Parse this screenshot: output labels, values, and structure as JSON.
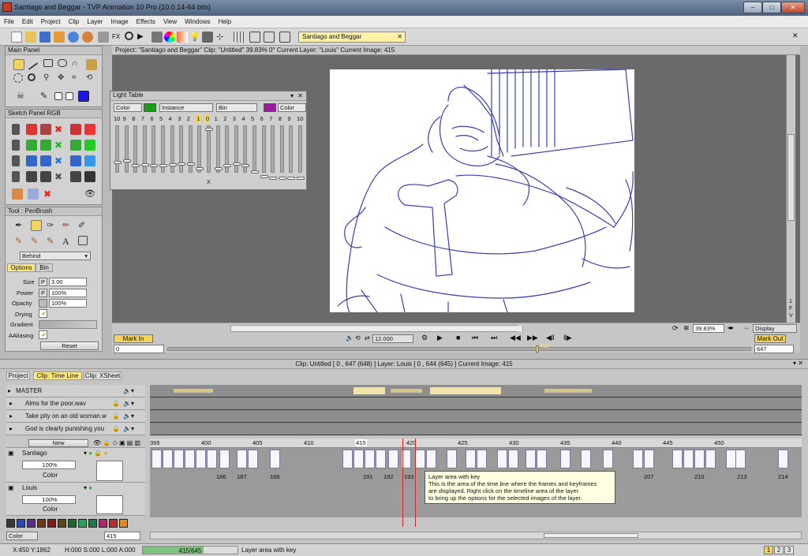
{
  "window": {
    "title": "Santiago and Beggar - TVP Animation 10 Pro (10.0.14-64 bits)"
  },
  "menu": [
    "File",
    "Edit",
    "Project",
    "Clip",
    "Layer",
    "Image",
    "Effects",
    "View",
    "Windows",
    "Help"
  ],
  "project_tab": "Santiago and Beggar",
  "main_panel": {
    "title": "Main Panel"
  },
  "sketch_panel": {
    "title": "Sketch Panel RGB"
  },
  "tool_panel": {
    "title": "Tool : PenBrush",
    "mode": "Behind",
    "tabs": [
      "Options",
      "Bin"
    ],
    "size": "3.00",
    "power": "100%",
    "opacity": "100%",
    "labels": {
      "size": "Size",
      "power": "Power",
      "opacity": "Opacity",
      "drying": "Drying",
      "gradient": "Gradient",
      "aaliasing": "AAliasing"
    },
    "reset": "Reset",
    "p": "P"
  },
  "view_header": "Project: \"Santiago and Beggar\"  Clip: \"Untitled\"  39.83%  0°  Current Layer: \"Louis\"  Current Image: 415",
  "light_table": {
    "title": "Light Table",
    "left_color": "Color",
    "mode": "Instance",
    "right_mode": "Bin",
    "right_color": "Color",
    "numbers": [
      "10",
      "9",
      "8",
      "7",
      "6",
      "5",
      "4",
      "3",
      "2",
      "1",
      "0",
      "1",
      "2",
      "3",
      "4",
      "5",
      "6",
      "7",
      "8",
      "9",
      "10"
    ],
    "x": "X"
  },
  "playbar": {
    "mark_in": "Mark In",
    "mark_out": "Mark Out",
    "fps": "12.000",
    "zoom": "39.83%",
    "display": "Display",
    "in_value": "0",
    "out_value": "647",
    "current": "415"
  },
  "clip_info": "Clip: Untitled [ 0 , 647  (648) ]      Layer: Louis [ 0 , 644  (645) ]     Current Image: 415",
  "tabs": [
    "Project",
    "Clip: Time Line",
    "Clip: XSheet"
  ],
  "sound_layers": [
    "MASTER",
    "Alms for the poor.wav",
    "Take pity on an old woman.w",
    "God is clearly punishing you"
  ],
  "layer_header": {
    "new": "New"
  },
  "layers": [
    {
      "name": "Santiago",
      "opacity": "100%",
      "blend": "Color"
    },
    {
      "name": "Louis",
      "opacity": "100%",
      "blend": "Color"
    }
  ],
  "ruler": [
    "395",
    "400",
    "405",
    "410",
    "415",
    "420",
    "425",
    "430",
    "435",
    "440",
    "445",
    "450"
  ],
  "frame_nums": [
    "186",
    "187",
    "188",
    "191",
    "192",
    "193",
    "207",
    "210",
    "213",
    "214"
  ],
  "tooltip": {
    "title": "Layer area with key",
    "l1": "This is the area of the time line where the frames and keyframes",
    "l2": "are displayed. Right click on the timeline area of the layer",
    "l3": "to bring up the options for the selected images of the layer."
  },
  "bottom": {
    "color": "Color",
    "frame": "415"
  },
  "status": {
    "coords": "X:450  Y:1862",
    "hms": "H:000 S:000 L:000 A:000",
    "progress": "415/645",
    "progress_frac": 0.643,
    "hint": "Layer area with key",
    "pages": [
      "1",
      "2",
      "3"
    ]
  },
  "side_letters": [
    "1",
    "F",
    "V"
  ],
  "colors": {
    "accent": "#2233cc",
    "sketch": "#3a3fb0"
  }
}
